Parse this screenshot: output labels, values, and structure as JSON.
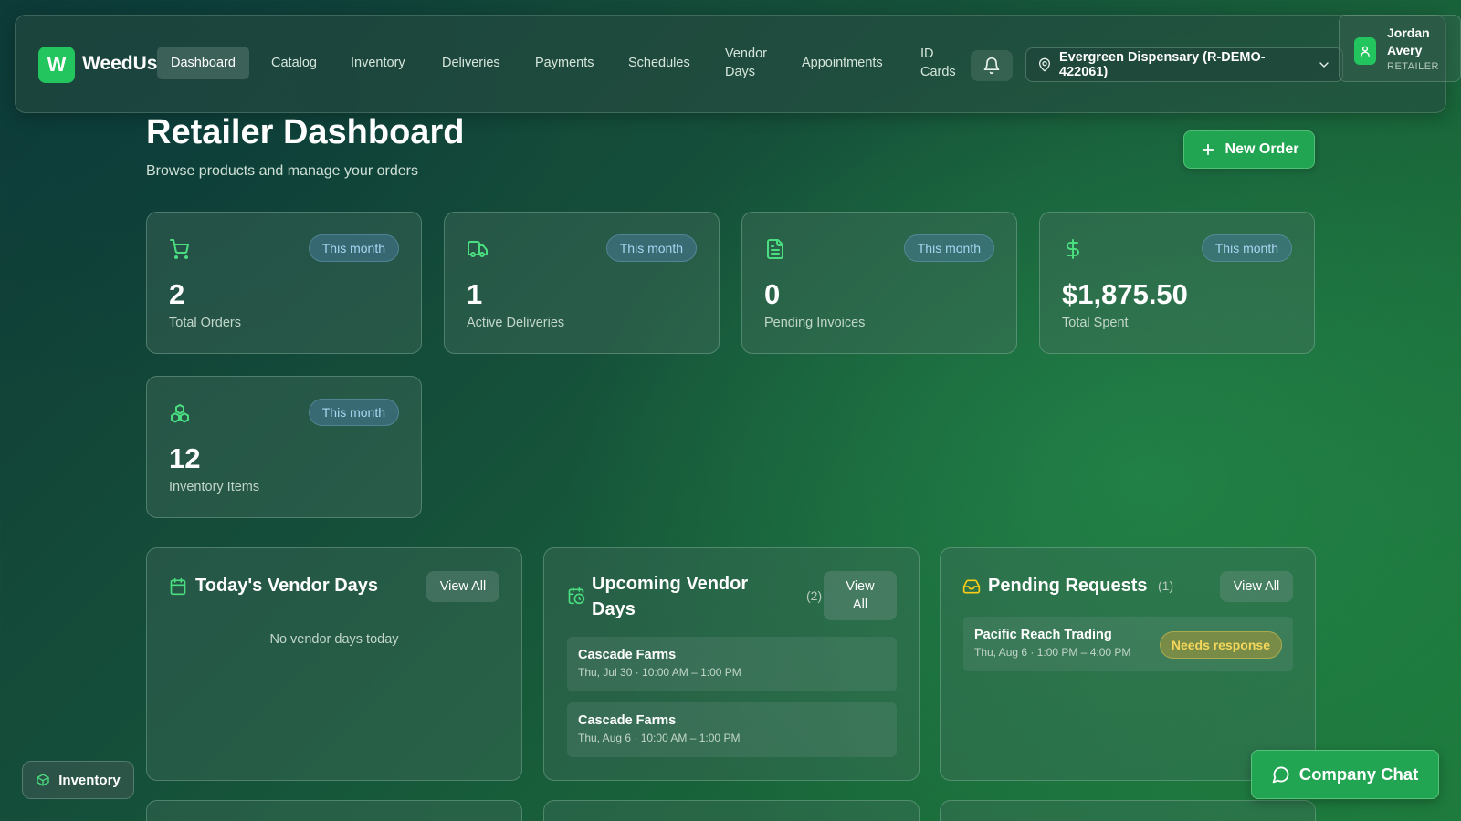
{
  "brand": {
    "logo_letter": "W",
    "name": "WeedUs"
  },
  "nav": {
    "items": [
      {
        "label": "Dashboard",
        "active": true
      },
      {
        "label": "Catalog"
      },
      {
        "label": "Inventory"
      },
      {
        "label": "Deliveries"
      },
      {
        "label": "Payments"
      },
      {
        "label": "Schedules"
      },
      {
        "label": "Vendor\nDays"
      },
      {
        "label": "Appointments"
      },
      {
        "label": "ID\nCards"
      }
    ],
    "bell_icon": "bell-icon",
    "location": "Evergreen Dispensary (R-DEMO-422061)",
    "user": {
      "name": "Jordan\nAvery",
      "role": "RETAILER"
    }
  },
  "header": {
    "title": "Retailer Dashboard",
    "subtitle": "Browse products and manage your orders",
    "new_order": "New Order"
  },
  "stats": [
    {
      "icon": "cart-icon",
      "badge": "This month",
      "value": "2",
      "label": "Total Orders"
    },
    {
      "icon": "truck-icon",
      "badge": "This month",
      "value": "1",
      "label": "Active Deliveries"
    },
    {
      "icon": "document-icon",
      "badge": "This month",
      "value": "0",
      "label": "Pending Invoices"
    },
    {
      "icon": "dollar-icon",
      "badge": "This month",
      "value": "$1,875.50",
      "label": "Total Spent"
    },
    {
      "icon": "boxes-icon",
      "badge": "This month",
      "value": "12",
      "label": "Inventory Items"
    }
  ],
  "panels": {
    "today": {
      "title": "Today's Vendor Days",
      "view_all": "View All",
      "empty": "No vendor days today"
    },
    "upcoming": {
      "title": "Upcoming Vendor Days",
      "count": "(2)",
      "view_all": "View\nAll",
      "items": [
        {
          "name": "Cascade Farms",
          "time": "Thu, Jul 30 · 10:00 AM – 1:00 PM"
        },
        {
          "name": "Cascade Farms",
          "time": "Thu, Aug 6 · 10:00 AM – 1:00 PM"
        }
      ]
    },
    "pending": {
      "title": "Pending Requests",
      "count": "(1)",
      "view_all": "View All",
      "items": [
        {
          "name": "Pacific Reach Trading",
          "time": "Thu, Aug 6 · 1:00 PM – 4:00 PM",
          "status": "Needs response"
        }
      ]
    }
  },
  "floating": {
    "inventory": "Inventory",
    "chat": "Company Chat"
  },
  "colors": {
    "accent": "#22c55e",
    "badge_blue": "#a9d6f2",
    "warn": "#f4d75a"
  }
}
